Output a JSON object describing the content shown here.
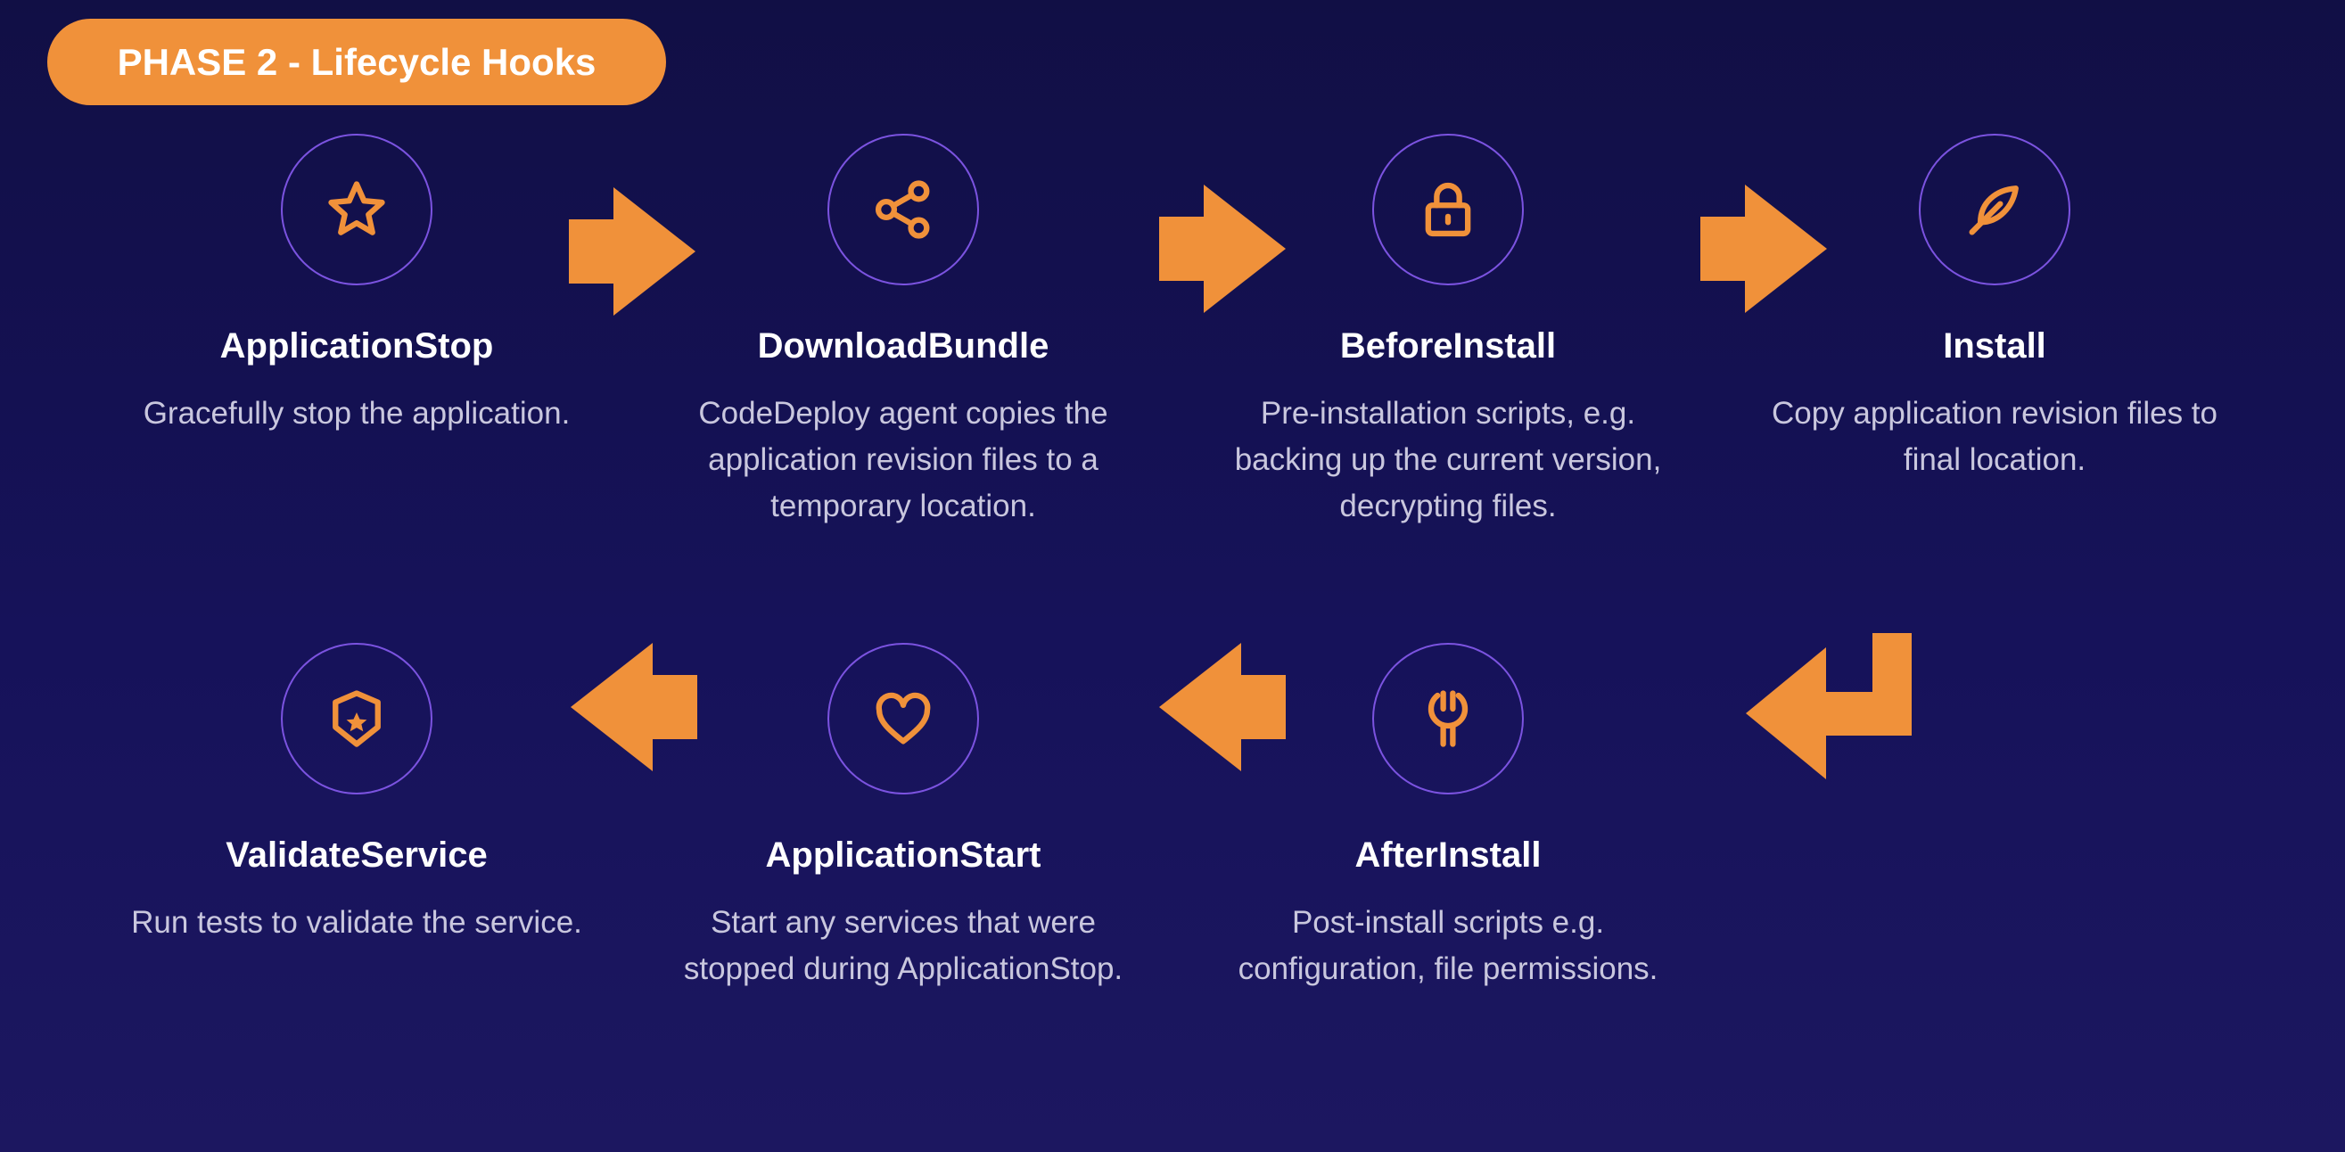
{
  "phase": {
    "label": "PHASE 2 - Lifecycle Hooks"
  },
  "colors": {
    "accent": "#f0913a",
    "circle_border": "#7b53e0",
    "title": "#ffffff",
    "description": "#c9c7de"
  },
  "steps": [
    {
      "title": "ApplicationStop",
      "description": "Gracefully stop the application.",
      "icon": "star-icon"
    },
    {
      "title": "DownloadBundle",
      "description": "CodeDeploy agent copies the application revision files to a temporary location.",
      "icon": "share-icon"
    },
    {
      "title": "BeforeInstall",
      "description": "Pre-installation scripts, e.g. backing up the current version, decrypting files.",
      "icon": "lock-icon"
    },
    {
      "title": "Install",
      "description": "Copy application revision files to final location.",
      "icon": "feather-icon"
    },
    {
      "title": "AfterInstall",
      "description": "Post-install scripts e.g. configuration, file permissions.",
      "icon": "wrench-icon"
    },
    {
      "title": "ApplicationStart",
      "description": "Start any services that were stopped during ApplicationStop.",
      "icon": "heart-icon"
    },
    {
      "title": "ValidateService",
      "description": "Run tests to validate the service.",
      "icon": "shield-star-icon"
    }
  ],
  "arrows": [
    {
      "from": "ApplicationStop",
      "to": "DownloadBundle",
      "direction": "right"
    },
    {
      "from": "DownloadBundle",
      "to": "BeforeInstall",
      "direction": "right"
    },
    {
      "from": "BeforeInstall",
      "to": "Install",
      "direction": "right"
    },
    {
      "from": "Install",
      "to": "AfterInstall",
      "direction": "down-left"
    },
    {
      "from": "AfterInstall",
      "to": "ApplicationStart",
      "direction": "left"
    },
    {
      "from": "ApplicationStart",
      "to": "ValidateService",
      "direction": "left"
    }
  ]
}
